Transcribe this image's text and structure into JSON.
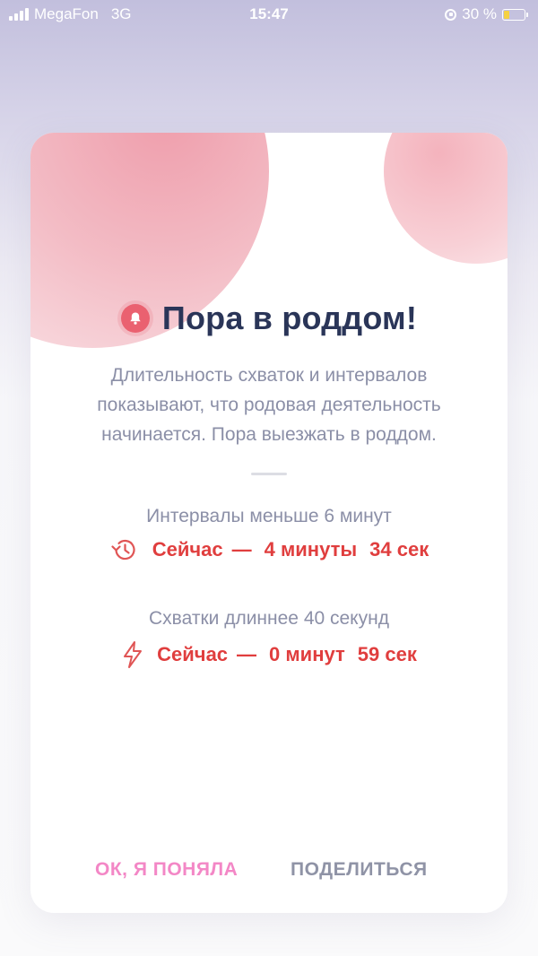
{
  "status_bar": {
    "carrier": "MegaFon",
    "network": "3G",
    "time": "15:47",
    "battery_percent": "30 %",
    "battery_level": 0.3
  },
  "alert": {
    "icon": "bell-icon",
    "title": "Пора в роддом!",
    "description": "Длительность схваток и интервалов показывают, что родовая деятельность начинается. Пора выезжать в роддом."
  },
  "intervals": {
    "label": "Интервалы меньше 6 минут",
    "icon": "history-icon",
    "now": "Сейчас",
    "dash": "—",
    "minutes": "4 минуты",
    "seconds": "34 сек"
  },
  "contractions": {
    "label": "Схватки длиннее 40 секунд",
    "icon": "lightning-icon",
    "now": "Сейчас",
    "dash": "—",
    "minutes": "0 минут",
    "seconds": "59 сек"
  },
  "buttons": {
    "ok": "ОК, Я ПОНЯЛА",
    "share": "ПОДЕЛИТЬСЯ"
  },
  "colors": {
    "accent_red": "#e03e3e",
    "ok_pink": "#f387c6",
    "title_navy": "#2a3558",
    "muted_text": "#8b8fa7"
  }
}
